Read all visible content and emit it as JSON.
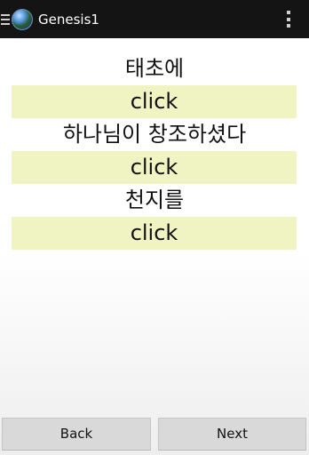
{
  "action_bar": {
    "title": "Genesis1",
    "app_icon": "earth-globe-icon",
    "menu_icon": "overflow-menu-icon"
  },
  "content": {
    "rows": [
      {
        "word": "태초에",
        "button_label": "click"
      },
      {
        "word": "하나님이 창조하셨다",
        "button_label": "click"
      },
      {
        "word": "천지를",
        "button_label": "click"
      }
    ]
  },
  "footer": {
    "back_label": "Back",
    "next_label": "Next"
  },
  "colors": {
    "action_bar_bg": "#141414",
    "click_box_bg": "#f0f4c2",
    "button_bg": "#d9d9d9"
  }
}
